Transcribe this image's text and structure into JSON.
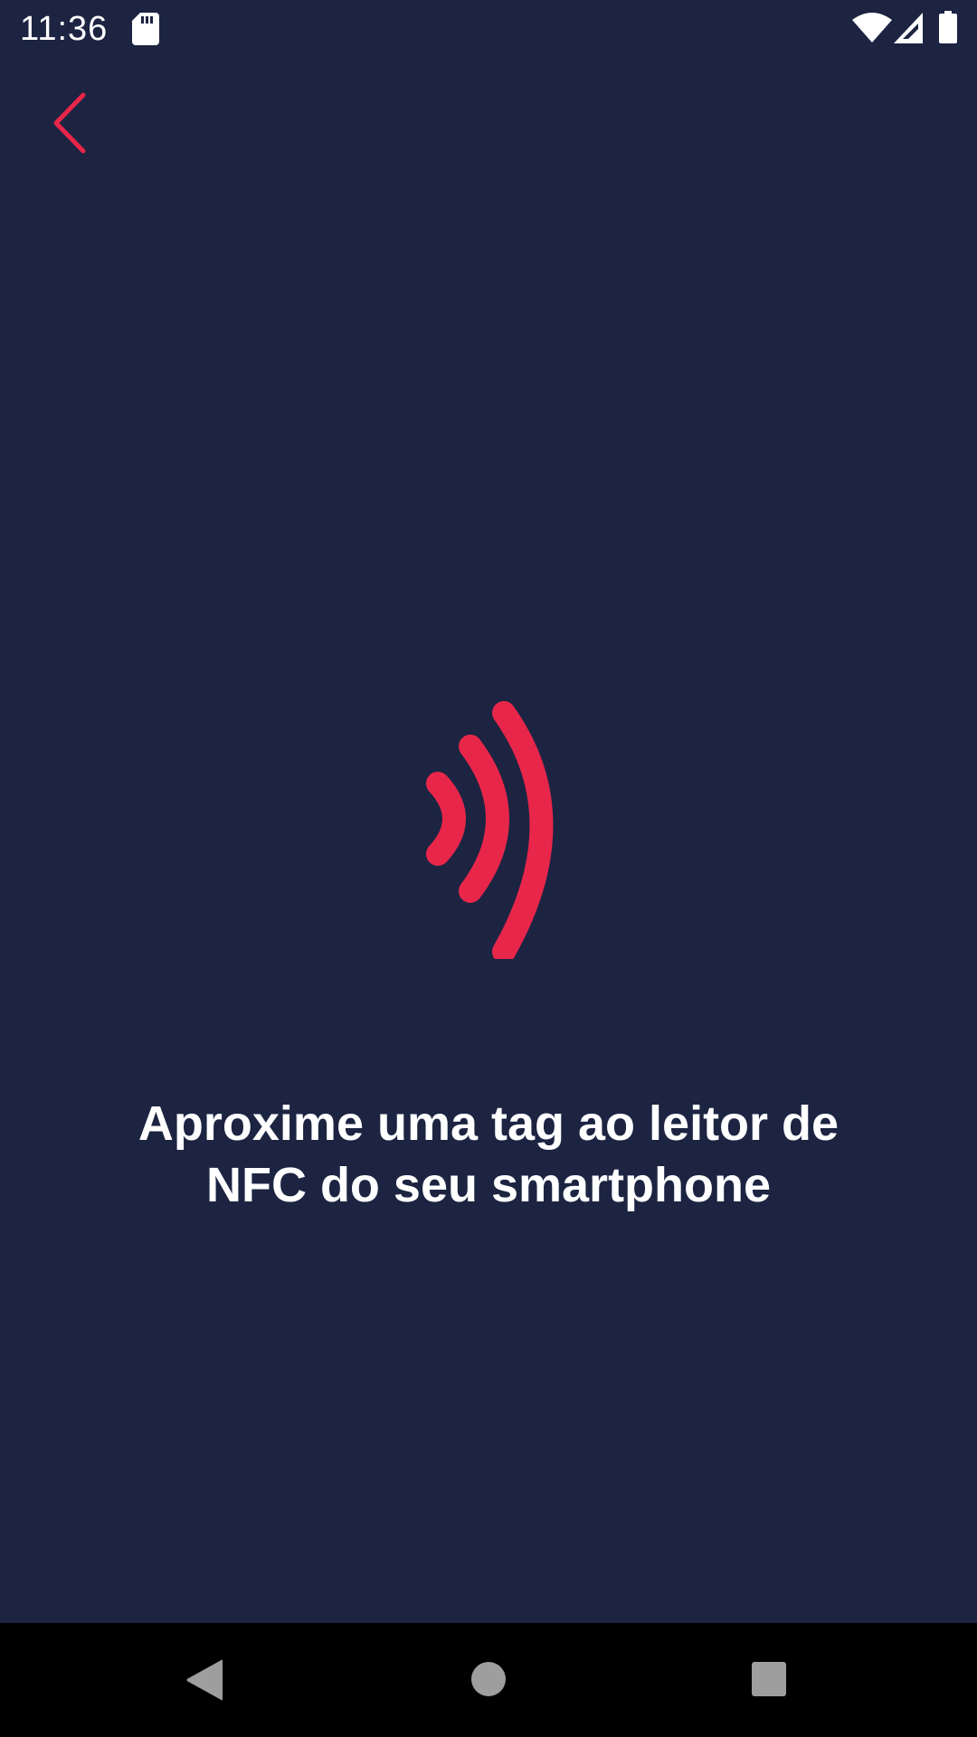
{
  "status_bar": {
    "time": "11:36",
    "icons": [
      "sd-card-icon",
      "wifi-icon",
      "cell-signal-icon",
      "battery-icon"
    ]
  },
  "header": {
    "back_icon": "chevron-left-icon"
  },
  "main": {
    "nfc_icon": "nfc-waves-icon",
    "instruction_line1": "Aproxime uma tag ao leitor de",
    "instruction_line2": "NFC do seu smartphone"
  },
  "nav_bar": {
    "icons": [
      "nav-back-icon",
      "nav-home-icon",
      "nav-recents-icon"
    ]
  },
  "colors": {
    "background": "#1c2442",
    "accent": "#e8264a",
    "text": "#ffffff",
    "nav_background": "#000000",
    "nav_icon": "#9e9e9e"
  }
}
